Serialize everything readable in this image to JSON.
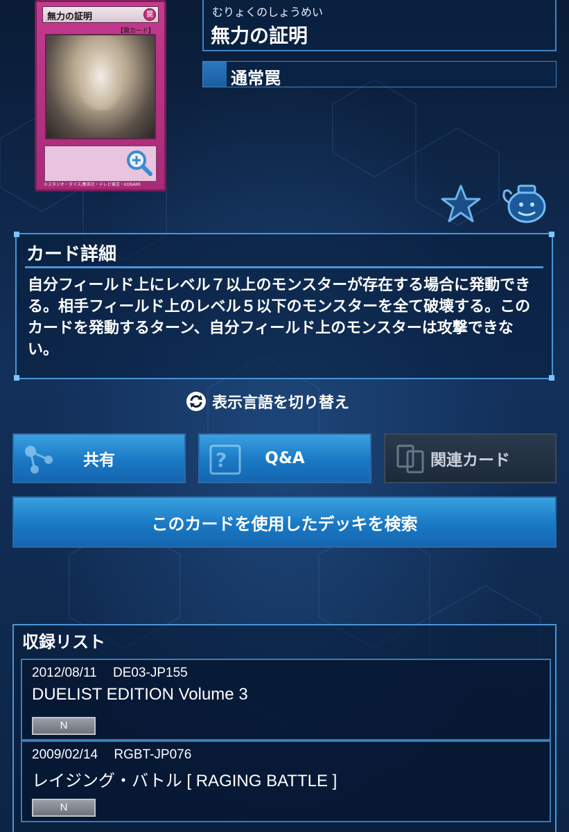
{
  "card": {
    "image_name": "無力の証明",
    "image_type_label": "【罠カード】",
    "image_attribute": "罠",
    "image_copyright": "©スタジオ・ダイス/集英社・テレビ東京・KONAMI",
    "name_ruby": "むりょくのしょうめい",
    "name": "無力の証明",
    "type": "通常罠"
  },
  "icons": {
    "zoom": "zoom-in-icon",
    "favorite": "star-icon",
    "pot": "pot-of-greed-icon",
    "lang": "refresh-icon",
    "share": "share-icon",
    "qa": "qa-icon",
    "related": "related-card-icon"
  },
  "detail": {
    "title": "カード詳細",
    "text": "自分フィールド上にレベル７以上のモンスターが存在する場合に発動できる。相手フィールド上のレベル５以下のモンスターを全て破壊する。このカードを発動するターン、自分フィールド上のモンスターは攻撃できない。"
  },
  "lang_toggle": {
    "label": "表示言語を切り替え"
  },
  "buttons": {
    "share": "共有",
    "qa": "Q&A",
    "related": "関連カード",
    "deck_search": "このカードを使用したデッキを検索"
  },
  "release_list": {
    "title": "収録リスト",
    "items": [
      {
        "date": "2012/08/11",
        "code": "DE03-JP155",
        "name": "DUELIST EDITION Volume 3",
        "rarity": "N"
      },
      {
        "date": "2009/02/14",
        "code": "RGBT-JP076",
        "name": "レイジング・バトル [ RAGING BATTLE ]",
        "rarity": "N"
      }
    ]
  },
  "colors": {
    "background": "#0d2140",
    "accent": "#4a96d8",
    "button": "#1a78c4",
    "trap_card": "#c43a8e"
  }
}
